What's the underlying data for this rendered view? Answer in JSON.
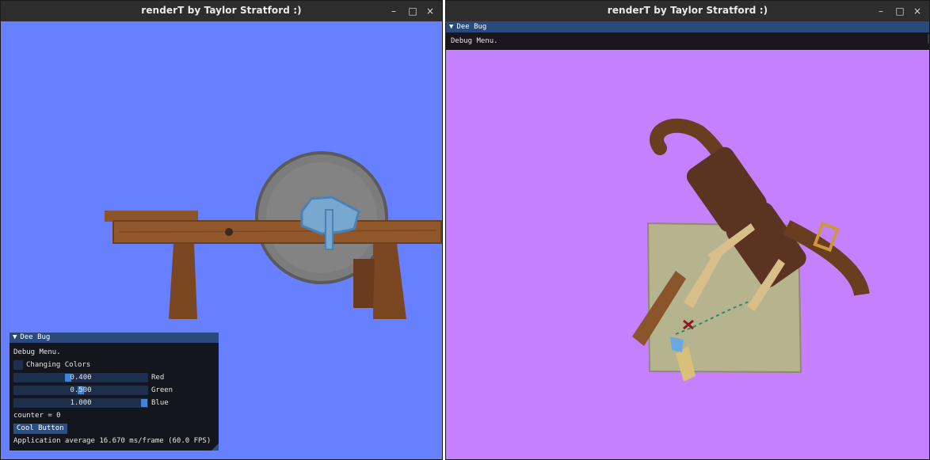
{
  "windows": [
    {
      "title": "renderT by Taylor Stratford :)",
      "controls": {
        "minimize": "–",
        "maximize": "□",
        "close": "×"
      },
      "background": "#6780ff",
      "imgui": {
        "header": "Dee Bug",
        "collapse_glyph": "▼",
        "text": "Debug Menu.",
        "checkbox_label": "Changing Colors",
        "checkbox_checked": false,
        "sliders": [
          {
            "label": "Red",
            "value": "0.400",
            "fraction": 0.4
          },
          {
            "label": "Green",
            "value": "0.500",
            "fraction": 0.5
          },
          {
            "label": "Blue",
            "value": "1.000",
            "fraction": 1.0
          }
        ],
        "counter_text": "counter = 0",
        "button_label": "Cool Button",
        "fps_text": "Application average 16.670 ms/frame (60.0 FPS)"
      }
    },
    {
      "title": "renderT by Taylor Stratford :)",
      "controls": {
        "minimize": "–",
        "maximize": "□",
        "close": "×"
      },
      "background": "#c580ff",
      "imgui": {
        "header": "Dee Bug",
        "collapse_glyph": "▼",
        "text": "Debug Menu."
      }
    }
  ]
}
